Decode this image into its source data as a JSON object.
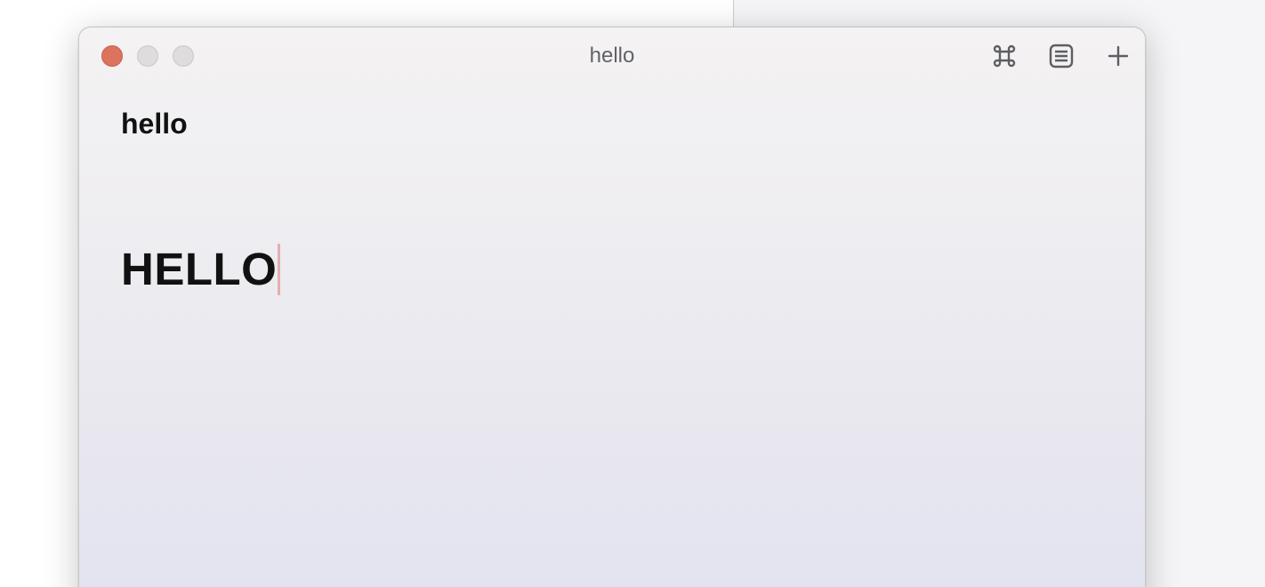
{
  "window": {
    "title": "hello"
  },
  "toolbar": {
    "icons": [
      "command-icon",
      "list-icon",
      "plus-icon"
    ]
  },
  "document": {
    "heading": "hello",
    "body_line": "HELLO"
  },
  "colors": {
    "close_button": "#dd735e",
    "caret": "#e3aeb0"
  }
}
